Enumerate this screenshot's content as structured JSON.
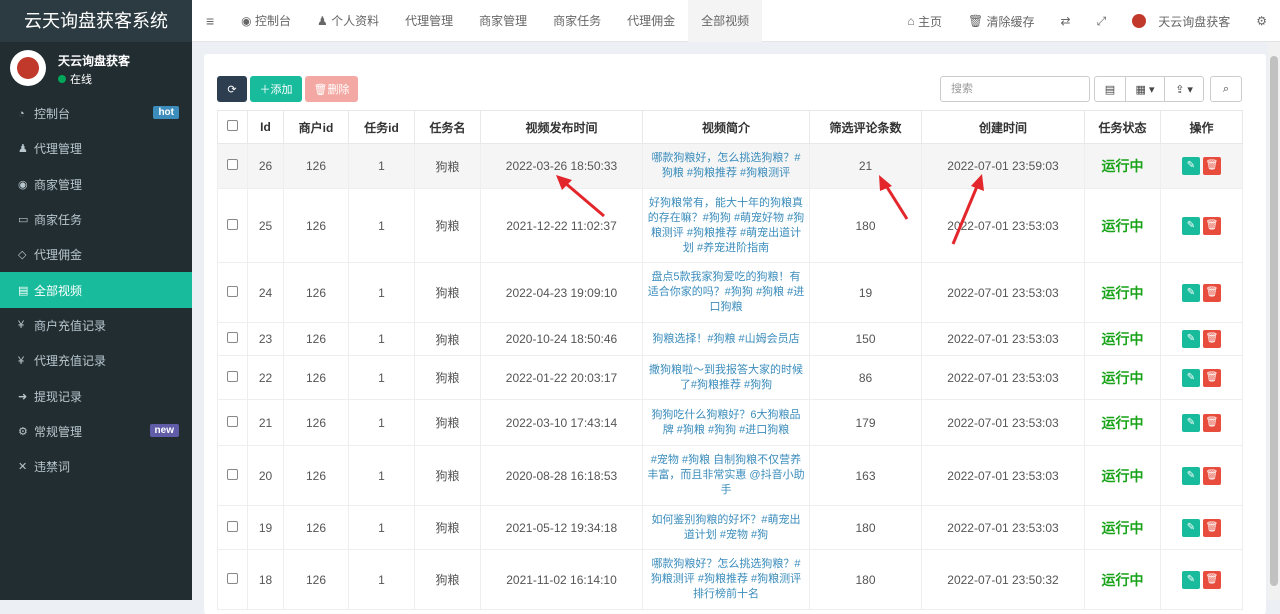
{
  "app": {
    "title": "云天询盘获客系统"
  },
  "user": {
    "name": "天云询盘获客",
    "status": "在线"
  },
  "sidebar": {
    "items": [
      {
        "label": "控制台",
        "icon": "dashboard-icon",
        "badge": "hot",
        "badge_color": "#3c8dbc"
      },
      {
        "label": "代理管理",
        "icon": "user-plus-icon"
      },
      {
        "label": "商家管理",
        "icon": "eye-icon"
      },
      {
        "label": "商家任务",
        "icon": "keyboard-icon"
      },
      {
        "label": "代理佣金",
        "icon": "diamond-icon"
      },
      {
        "label": "全部视频",
        "icon": "file-icon",
        "active": true
      },
      {
        "label": "商户充值记录",
        "icon": "yen-icon"
      },
      {
        "label": "代理充值记录",
        "icon": "yen-icon"
      },
      {
        "label": "提现记录",
        "icon": "sign-in-icon"
      },
      {
        "label": "常规管理",
        "icon": "cogs-icon",
        "badge": "new",
        "badge_color": "#605ca8"
      },
      {
        "label": "违禁词",
        "icon": "close-icon"
      }
    ]
  },
  "topbar": {
    "tabs": [
      "控制台",
      "个人资料",
      "代理管理",
      "商家管理",
      "商家任务",
      "代理佣金",
      "全部视频"
    ],
    "home": "主页",
    "clear_cache": "清除缓存",
    "account": "天云询盘获客"
  },
  "toolbar": {
    "add": "添加",
    "delete": "删除",
    "search_placeholder": "搜索"
  },
  "table": {
    "headers": [
      "Id",
      "商户id",
      "任务id",
      "任务名",
      "视频发布时间",
      "视频简介",
      "筛选评论条数",
      "创建时间",
      "任务状态",
      "操作"
    ],
    "rows": [
      {
        "id": "26",
        "merchant": "126",
        "task": "1",
        "name": "狗粮",
        "pub": "2022-03-26 18:50:33",
        "desc": "哪款狗粮好，怎么挑选狗粮？#狗粮 #狗粮推荐 #狗粮测评",
        "count": "21",
        "created": "2022-07-01 23:59:03",
        "status": "运行中"
      },
      {
        "id": "25",
        "merchant": "126",
        "task": "1",
        "name": "狗粮",
        "pub": "2021-12-22 11:02:37",
        "desc": "好狗粮常有，能大十年的狗粮真的存在嘛？#狗狗 #萌宠好物 #狗粮测评 #狗粮推荐 #萌宠出道计划 #养宠进阶指南",
        "count": "180",
        "created": "2022-07-01 23:53:03",
        "status": "运行中"
      },
      {
        "id": "24",
        "merchant": "126",
        "task": "1",
        "name": "狗粮",
        "pub": "2022-04-23 19:09:10",
        "desc": "盘点5款我家狗爱吃的狗粮！有适合你家的吗？#狗狗 #狗粮 #进口狗粮",
        "count": "19",
        "created": "2022-07-01 23:53:03",
        "status": "运行中"
      },
      {
        "id": "23",
        "merchant": "126",
        "task": "1",
        "name": "狗粮",
        "pub": "2020-10-24 18:50:46",
        "desc": "狗粮选择！#狗粮 #山姆会员店",
        "count": "150",
        "created": "2022-07-01 23:53:03",
        "status": "运行中"
      },
      {
        "id": "22",
        "merchant": "126",
        "task": "1",
        "name": "狗粮",
        "pub": "2022-01-22 20:03:17",
        "desc": "撒狗粮啦～到我报答大家的时候了#狗粮推荐 #狗狗",
        "count": "86",
        "created": "2022-07-01 23:53:03",
        "status": "运行中"
      },
      {
        "id": "21",
        "merchant": "126",
        "task": "1",
        "name": "狗粮",
        "pub": "2022-03-10 17:43:14",
        "desc": "狗狗吃什么狗粮好？6大狗粮品牌 #狗粮 #狗狗 #进口狗粮",
        "count": "179",
        "created": "2022-07-01 23:53:03",
        "status": "运行中"
      },
      {
        "id": "20",
        "merchant": "126",
        "task": "1",
        "name": "狗粮",
        "pub": "2020-08-28 16:18:53",
        "desc": "#宠物 #狗粮 自制狗粮不仅营养丰富，而且非常实惠 @抖音小助手",
        "count": "163",
        "created": "2022-07-01 23:53:03",
        "status": "运行中"
      },
      {
        "id": "19",
        "merchant": "126",
        "task": "1",
        "name": "狗粮",
        "pub": "2021-05-12 19:34:18",
        "desc": "如何鉴别狗粮的好坏？#萌宠出道计划 #宠物 #狗",
        "count": "180",
        "created": "2022-07-01 23:53:03",
        "status": "运行中"
      },
      {
        "id": "18",
        "merchant": "126",
        "task": "1",
        "name": "狗粮",
        "pub": "2021-11-02 16:14:10",
        "desc": "哪款狗粮好？怎么挑选狗粮？#狗粮测评 #狗粮推荐 #狗粮测评排行榜前十名",
        "count": "180",
        "created": "2022-07-01 23:50:32",
        "status": "运行中"
      }
    ]
  },
  "colors": {
    "sidebar_bg": "#222d32",
    "active": "#18bc9c",
    "add": "#18bc9c",
    "delete": "#f4a8a3",
    "edit": "#18bc9c",
    "del_btn": "#e74c3c",
    "status": "#18a318",
    "arrow": "#e3262b"
  }
}
